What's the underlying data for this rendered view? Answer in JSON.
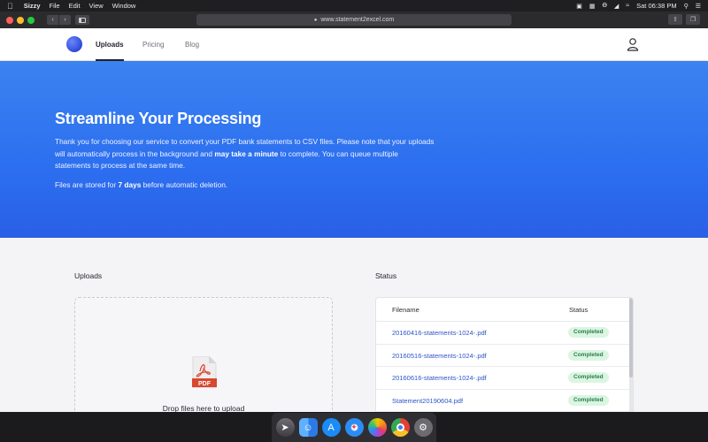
{
  "menubar": {
    "app": "Sizzy",
    "menus": [
      "File",
      "Edit",
      "View",
      "Window"
    ],
    "clock": "Sat 06:38 PM"
  },
  "browser": {
    "url": "www.statement2excel.com"
  },
  "nav": {
    "links": [
      {
        "label": "Uploads",
        "active": true
      },
      {
        "label": "Pricing",
        "active": false
      },
      {
        "label": "Blog",
        "active": false
      }
    ]
  },
  "hero": {
    "title": "Streamline Your Processing",
    "para_1": "Thank you for choosing our service to convert your PDF bank statements to CSV files. Please note that your uploads will automatically process in the background and ",
    "para_bold": "may take a minute",
    "para_2": " to complete. You can queue multiple statements to process at the same time.",
    "note_1": "Files are stored for ",
    "note_bold": "7 days",
    "note_2": " before automatic deletion."
  },
  "uploads": {
    "title": "Uploads",
    "drop_text": "Drop files here to upload",
    "pdf_label": "PDF"
  },
  "status": {
    "title": "Status",
    "columns": [
      "Filename",
      "Status"
    ],
    "rows": [
      {
        "filename": "20160416-statements-1024-.pdf",
        "status": "Completed"
      },
      {
        "filename": "20160516-statements-1024-.pdf",
        "status": "Completed"
      },
      {
        "filename": "20160616-statements-1024-.pdf",
        "status": "Completed"
      },
      {
        "filename": "Statement20190604.pdf",
        "status": "Completed"
      }
    ]
  },
  "colors": {
    "hero_gradient": [
      "#3c82f0",
      "#2a5fe6"
    ],
    "link": "#2d55c7",
    "badge_bg": "#dbf5e2",
    "badge_text": "#27804a"
  },
  "dock": {
    "icons": [
      "launchpad-icon",
      "finder-icon",
      "app-store-icon",
      "safari-icon",
      "photos-icon",
      "chrome-icon",
      "system-preferences-icon"
    ]
  }
}
